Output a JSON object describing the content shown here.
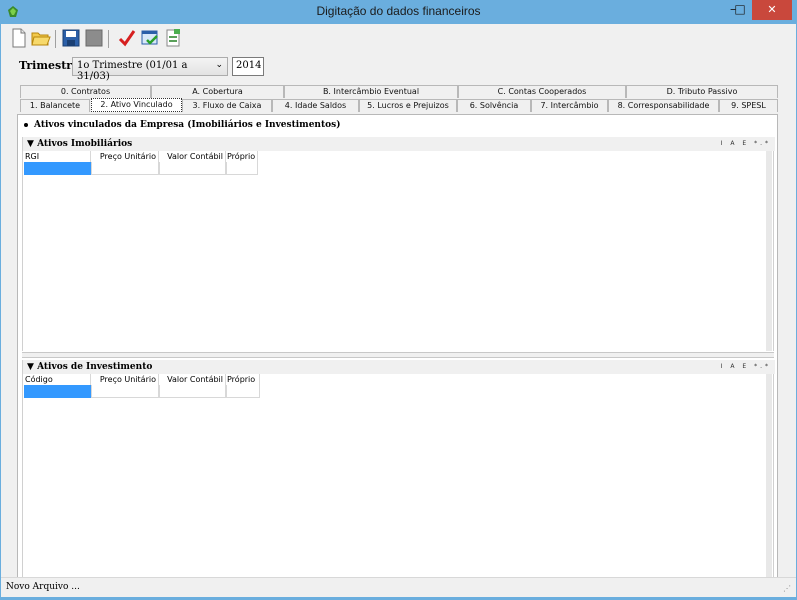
{
  "window": {
    "title": "Digitação do dados financeiros",
    "minimize": "–",
    "maximize": "□",
    "close": "✕"
  },
  "toolbar": {
    "icons": [
      "new-file-icon",
      "open-folder-icon",
      "save-icon",
      "disabled-save-icon",
      "check-icon",
      "validate-icon",
      "export-icon"
    ]
  },
  "trimestre": {
    "label": "Trimestre",
    "selected": "1o Trimestre (01/01 a 31/03)",
    "year": "2014"
  },
  "tabs_top": [
    {
      "label": "0. Contratos"
    },
    {
      "label": "A. Cobertura"
    },
    {
      "label": "B. Intercâmbio Eventual"
    },
    {
      "label": "C. Contas Cooperados"
    },
    {
      "label": "D. Tributo Passivo"
    }
  ],
  "tabs_bottom": [
    {
      "label": "1. Balancete"
    },
    {
      "label": "2. Ativo Vinculado",
      "active": true
    },
    {
      "label": "3. Fluxo de Caixa"
    },
    {
      "label": "4. Idade Saldos"
    },
    {
      "label": "5. Lucros e Prejuizos"
    },
    {
      "label": "6. Solvência"
    },
    {
      "label": "7. Intercâmbio"
    },
    {
      "label": "8. Corresponsabilidade"
    },
    {
      "label": "9. SPESL"
    }
  ],
  "panel": {
    "heading": "Ativos vinculados da Empresa (Imobiliários e Investimentos)"
  },
  "imobiliarios": {
    "toggle": "▼",
    "title": "Ativos Imobiliários",
    "controls": "I A E *.*",
    "columns": [
      "RGI",
      "Preço Unitário",
      "Valor Contábil",
      "Próprio"
    ]
  },
  "investimento": {
    "toggle": "▼",
    "title": "Ativos de Investimento",
    "controls": "I A E *.*",
    "columns": [
      "Código",
      "Preço Unitário",
      "Valor Contábil",
      "Próprio"
    ]
  },
  "status": {
    "text": "Novo Arquivo ..."
  },
  "colors": {
    "titlebar": "#6aaede",
    "close": "#c9483c",
    "selection": "#3399ff"
  }
}
